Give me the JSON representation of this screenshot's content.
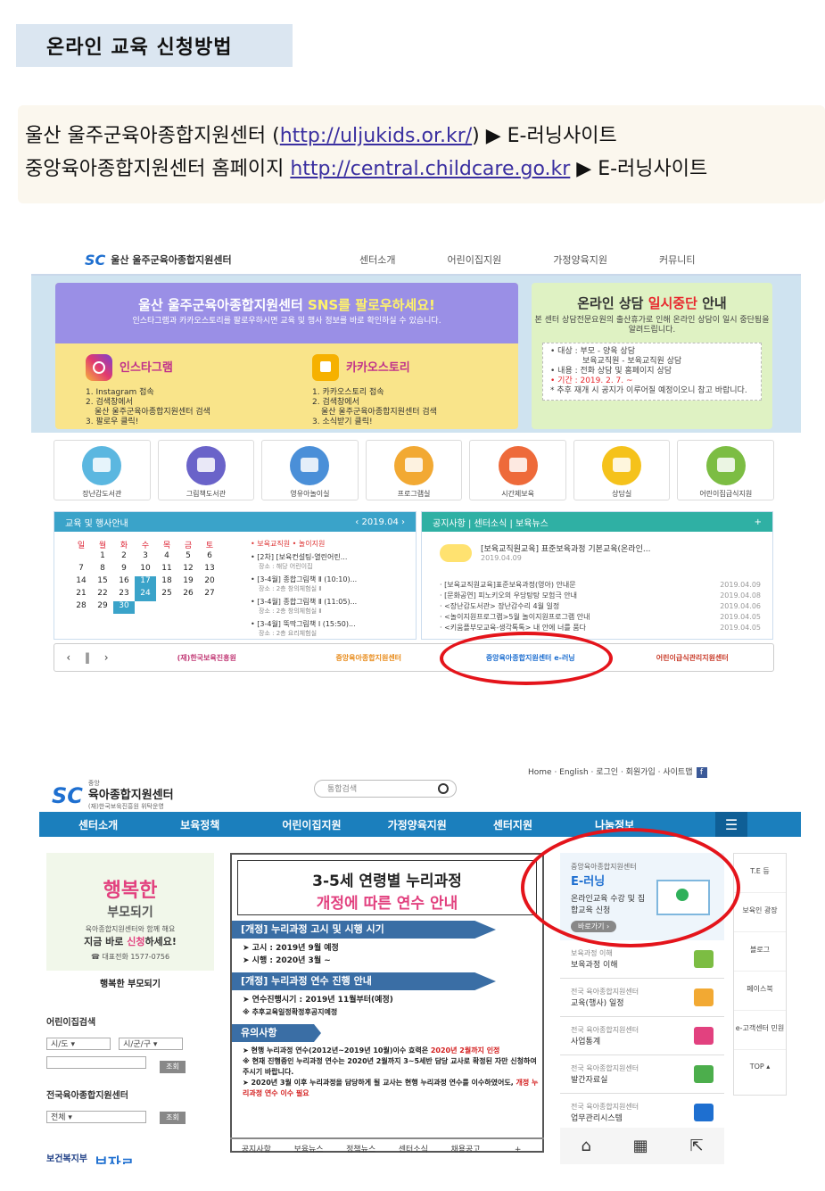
{
  "title": "온라인 교육 신청방법",
  "intro": {
    "line1_prefix": "울산 울주군육아종합지원센터 (",
    "line1_url": "http://uljukids.or.kr/",
    "line1_suffix": ") ▶ E-러닝사이트",
    "line2_prefix": "중앙육아종합지원센터 홈페이지 ",
    "line2_url": "http://central.childcare.go.kr",
    "line2_suffix": " ▶ E-러닝사이트"
  },
  "shot1": {
    "logo": "울산 울주군육아종합지원센터",
    "nav": [
      "센터소개",
      "어린이집지원",
      "가정양육지원",
      "커뮤니티"
    ],
    "sns": {
      "heading_a": "울산 울주군육아종합지원센터 ",
      "heading_b": "SNS를 팔로우하세요!",
      "desc": "인스타그램과 카카오스토리를 팔로우하시면 교육 및 행사 정보를 바로 확인하실 수 있습니다.",
      "insta_title": "인스타그램",
      "insta_steps": [
        "1. Instagram 접속",
        "2. 검색창에서",
        "울산 울주군육아종합지원센터 검색",
        "3. 팔로우 클릭!"
      ],
      "kakao_title": "카카오스토리",
      "kakao_steps": [
        "1. 카카오스토리 접속",
        "2. 검색창에서",
        "울산 울주군육아종합지원센터 검색",
        "3. 소식받기 클릭!"
      ]
    },
    "consult": {
      "heading_a": "온라인 상담 ",
      "heading_b": "일시중단",
      "heading_c": " 안내",
      "desc": "본 센터 상담전문요원의 출산휴가로 인해 온라인 상담이 일시 중단됨을 알려드립니다.",
      "items": [
        "• 대상 : 부모 - 양육 상담",
        "보육교직원 - 보육교직원 상담",
        "• 내용 : 전화 상담 및 홈페이지 상담",
        "• 기간 : 2019. 2. 7. ~",
        "* 추후 재개 시 공지가 이루어질 예정이오니 참고 바랍니다."
      ]
    },
    "icons": [
      {
        "label": "장난감도서관",
        "color": "#5bb7e0",
        "name": "toy-library-icon"
      },
      {
        "label": "그림책도서관",
        "color": "#6a63c9",
        "name": "picture-book-icon"
      },
      {
        "label": "영유아놀이실",
        "color": "#4a8fd8",
        "name": "playroom-icon"
      },
      {
        "label": "프로그램실",
        "color": "#f2a933",
        "name": "program-room-icon"
      },
      {
        "label": "시간제보육",
        "color": "#ee6a3a",
        "name": "hourly-care-icon"
      },
      {
        "label": "상담실",
        "color": "#f5c21b",
        "name": "counseling-icon"
      },
      {
        "label": "어린이집급식지원",
        "color": "#7cbd43",
        "name": "meal-support-icon"
      }
    ],
    "calendar": {
      "title": "교육 및 행사안내",
      "month": "‹  2019.04  ›",
      "days": [
        "일",
        "월",
        "화",
        "수",
        "목",
        "금",
        "토"
      ],
      "weeks": [
        [
          "",
          "1",
          "2",
          "3",
          "4",
          "5",
          "6"
        ],
        [
          "7",
          "8",
          "9",
          "10",
          "11",
          "12",
          "13"
        ],
        [
          "14",
          "15",
          "16",
          "17",
          "18",
          "19",
          "20"
        ],
        [
          "21",
          "22",
          "23",
          "24",
          "25",
          "26",
          "27"
        ],
        [
          "28",
          "29",
          "30",
          "",
          "",
          "",
          ""
        ]
      ],
      "legend": "• 보육교직원   • 놀이지원",
      "events": [
        {
          "t": "• [2차] [보육컨설팅-열린어린...",
          "s": "장소 : 해당 어린이집"
        },
        {
          "t": "• [3-4월] 종합그림책 Ⅱ (10:10)...",
          "s": "장소 : 2층 창의체험실 Ⅱ"
        },
        {
          "t": "• [3-4월] 종합그림책 Ⅱ (11:05)...",
          "s": "장소 : 2층 창의체험실 Ⅱ"
        },
        {
          "t": "• [3-4월] 뚝딱그림책 Ⅰ (15:50)...",
          "s": "장소 : 2층 요리체험실"
        }
      ]
    },
    "notice": {
      "tabs": "공지사항  |  센터소식  |  보육뉴스",
      "plus": "+",
      "main_title": "[보육교직원교육] 표준보육과정 기본교육(온라인...",
      "main_date": "2019.04.09",
      "rows": [
        [
          "· [보육교직원교육]표준보육과정(영아) 안내문",
          "2019.04.09"
        ],
        [
          "· [문화공연] 피노키오의 우당탕탕 모험극 안내",
          "2019.04.08"
        ],
        [
          "· <장난감도서관> 장난감수리 4월 일정",
          "2019.04.06"
        ],
        [
          "· <놀이지원프로그램>5월 놀이지원프로그램 안내",
          "2019.04.05"
        ],
        [
          "· <키움플부모교육-생각톡톡> 내 안에 너를 품다",
          "2019.04.05"
        ]
      ]
    },
    "links": {
      "controls": "‹ ‖ ›",
      "items": [
        "(재)한국보육진흥원",
        "중앙육아종합지원센터",
        "중앙육아종합지원센터 e-러닝",
        "어린이급식관리지원센터"
      ]
    }
  },
  "shot2": {
    "top_links": "Home · English · 로그인 · 회원가입 · 사이트맵",
    "fb": "f",
    "logo_small": "중앙",
    "logo_main": "육아종합지원센터",
    "logo_sub": "(재)한국보육진흥원 위탁운영",
    "search_placeholder": "통합검색",
    "nav": [
      "센터소개",
      "보육정책",
      "어린이집지원",
      "가정양육지원",
      "센터지원",
      "나눔정보"
    ],
    "menu_icon": "☰",
    "promo": {
      "big": "행복한",
      "big2": "부모되기",
      "sub": "육아종합지원센터와 함께 해요",
      "call_a": "지금 바로 ",
      "call_b": "신청",
      "call_c": "하세요!",
      "phone": "☎ 대표전화 1577-0756",
      "caption": "행복한 부모되기"
    },
    "daycare_search": {
      "label": "어린이집검색",
      "sel1": "시/도   ▾",
      "sel2": "시/군/구 ▾",
      "btn": "조회"
    },
    "center_search": {
      "label": "전국육아종합지원센터",
      "sel": "전체                  ▾",
      "btn": "조회"
    },
    "bottom_logos": [
      "보건복지부",
      "보자ㄹ"
    ],
    "center": {
      "head1": "3-5세 연령별 누리과정",
      "head2": "개정에 따른 연수 안내",
      "sec1": "[개정] 누리과정 고시 및 시행 시기",
      "sec1_items": [
        "➤ 고시 : 2019년 9월 예정",
        "➤ 시행 : 2020년 3월 ~"
      ],
      "sec2": "[개정] 누리과정 연수 진행 안내",
      "sec2_items": [
        "➤ 연수진행시기 : 2019년 11월부터(예정)",
        "※ 추후교육일정확정후공지예정"
      ],
      "sec3": "유의사항",
      "sec3_a": "➤ 현행 누리과정 연수(2012년~2019년 10월)이수 효력은 ",
      "sec3_a_red": "2020년 2월까지 인정",
      "sec3_b": "※ 현재 진행중인 누리과정 연수는 2020년 2월까지 3~5세반 담당 교사로 확정된 자만 신청하여 주시기 바랍니다.",
      "sec3_c": "➤ 2020년 3월 이후 누리과정을 담당하게 될 교사는 현행 누리과정 연수를 이수하였어도, ",
      "sec3_c_red": "개정 누리과정 연수 이수 필요",
      "tabs": [
        "공지사항",
        "보육뉴스",
        "정책뉴스",
        "센터소식",
        "채용공고",
        "+"
      ]
    },
    "right": {
      "elearn_small": "중앙육아종합지원센터",
      "elearn_title": "E-러닝",
      "elearn_desc": "온라인교육 수강 및 집합교육 신청",
      "elearn_btn": "바로가기 ›",
      "cards": [
        {
          "small": "보육과정 이해",
          "title": "보육과정 이해",
          "color": "#7cbd43",
          "name": "plant-icon"
        },
        {
          "small": "전국 육아종합지원센터",
          "title": "교육(행사) 일정",
          "color": "#f2a933",
          "name": "calendar-30-icon"
        },
        {
          "small": "전국 육아종합지원센터",
          "title": "사업통계",
          "color": "#e2417f",
          "name": "stats-icon"
        },
        {
          "small": "전국 육아종합지원센터",
          "title": "발간자료실",
          "color": "#4cae4c",
          "name": "publication-icon"
        },
        {
          "small": "전국 육아종합지원센터",
          "title": "업무관리시스템",
          "color": "#1e6fd0",
          "name": "system-icon"
        }
      ]
    },
    "far": [
      "T.E 등",
      "보육인 광장",
      "블로그",
      "페이스북",
      "e-고객센터 민원",
      "TOP ▴"
    ],
    "bottom_icons": [
      "⌂",
      "▦",
      "⇱"
    ]
  }
}
